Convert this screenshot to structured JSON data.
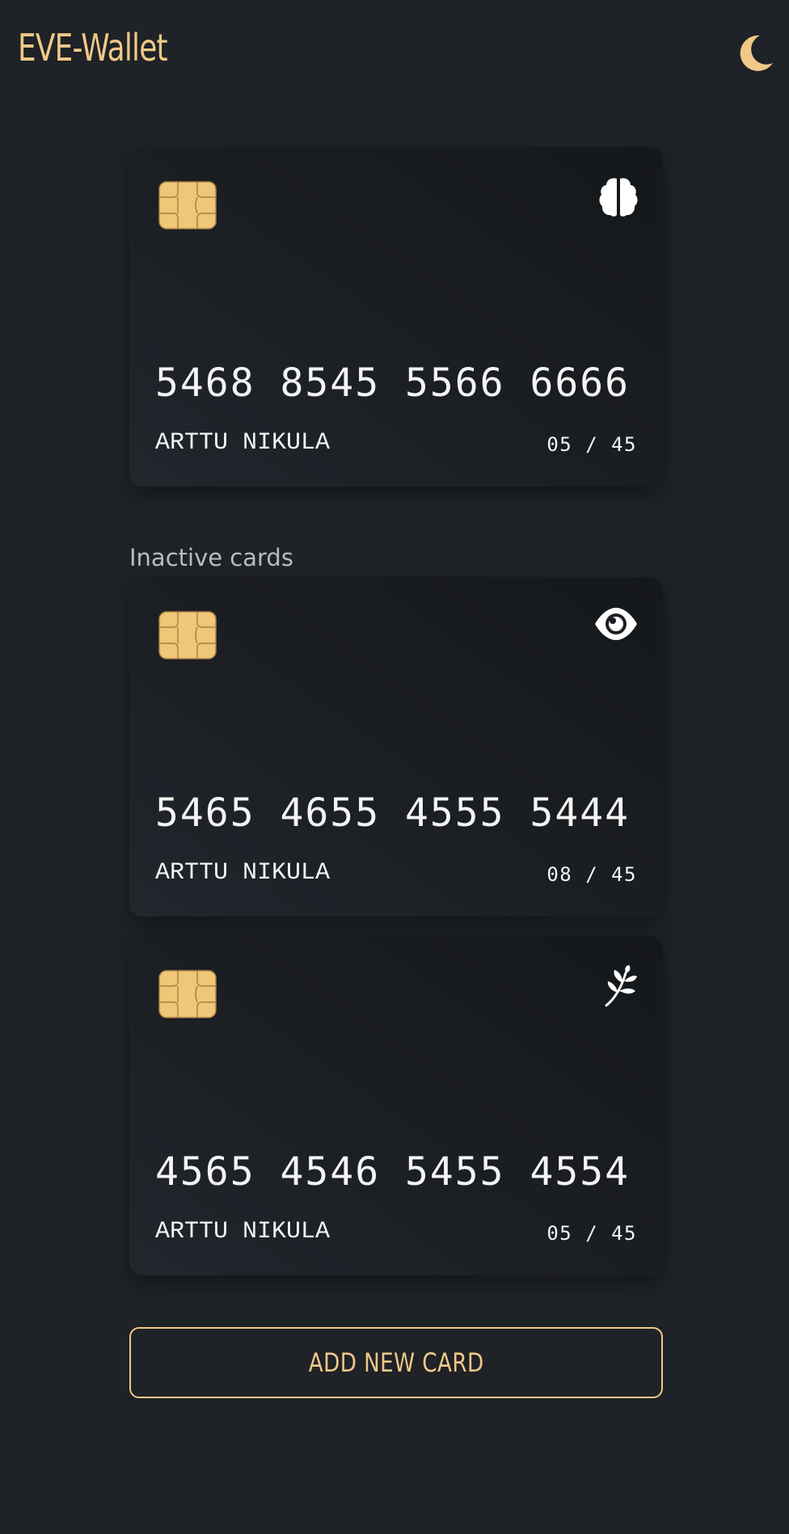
{
  "header": {
    "title": "EVE-Wallet",
    "theme_icon": "moon-icon"
  },
  "colors": {
    "accent": "#f0c888",
    "background": "#1f2226",
    "card_text": "#f4f4f4",
    "chip": "#f0c678"
  },
  "active_card": {
    "number": "5468 8545 5566 6666",
    "holder": "ARTTU NIKULA",
    "expiry": "05 / 45",
    "logo_icon": "brain-icon",
    "chip_icon": "chip-icon"
  },
  "inactive_section": {
    "heading": "Inactive cards"
  },
  "inactive_cards": [
    {
      "number": "5465 4655 4555 5444",
      "holder": "ARTTU NIKULA",
      "expiry": "08 / 45",
      "logo_icon": "eye-icon",
      "chip_icon": "chip-icon"
    },
    {
      "number": "4565 4546 5455 4554",
      "holder": "ARTTU NIKULA",
      "expiry": "05 / 45",
      "logo_icon": "leaf-icon",
      "chip_icon": "chip-icon"
    }
  ],
  "actions": {
    "add_card_label": "ADD NEW CARD"
  }
}
